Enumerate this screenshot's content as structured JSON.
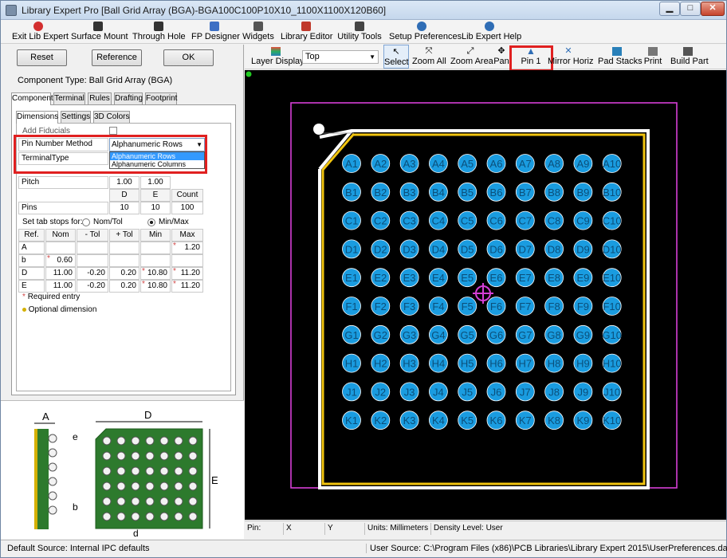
{
  "window": {
    "title": "Library Expert Pro [Ball Grid Array (BGA)-BGA100C100P10X10_1100X1100X120B60]"
  },
  "menu": [
    {
      "label": "Exit Lib Expert",
      "icon": "exit-icon",
      "color": "#d32f2f"
    },
    {
      "label": "Surface Mount",
      "icon": "chip-icon",
      "color": "#333333"
    },
    {
      "label": "Through Hole",
      "icon": "through-hole-icon",
      "color": "#333333"
    },
    {
      "label": "FP Designer",
      "icon": "pencil-icon",
      "color": "#3d6fc4"
    },
    {
      "label": "Widgets",
      "icon": "widgets-icon",
      "color": "#555555"
    },
    {
      "label": "Library Editor",
      "icon": "library-icon",
      "color": "#c0392b"
    },
    {
      "label": "Utility Tools",
      "icon": "tools-icon",
      "color": "#444444"
    },
    {
      "label": "Setup Preferences",
      "icon": "gear-icon",
      "color": "#2f6db5"
    },
    {
      "label": "Lib Expert Help",
      "icon": "help-icon",
      "color": "#2f6db5"
    }
  ],
  "left": {
    "buttons": {
      "reset": "Reset",
      "reference": "Reference",
      "ok": "OK"
    },
    "component_type": "Component Type: Ball Grid Array (BGA)",
    "tabs": [
      "Component",
      "Terminal",
      "Rules",
      "Drafting",
      "Footprint"
    ],
    "subtabs": [
      "Dimensions",
      "Settings",
      "3D Colors"
    ],
    "add_fiducials": "Add Fiducials",
    "pin_number_method_label": "Pin Number Method",
    "pin_number_method_value": "Alphanumeric Rows",
    "dropdown_options": [
      "Alphanumeric Rows",
      "Alphanumeric Columns"
    ],
    "terminal_type_label": "TerminalType",
    "pitch_label": "Pitch",
    "pitch_values": [
      "1.00",
      "1.00"
    ],
    "count_headers": [
      "D",
      "E",
      "Count"
    ],
    "pins_label": "Pins",
    "pins_values": [
      "10",
      "10",
      "100"
    ],
    "tab_stops_label": "Set tab stops for:",
    "radio_nom": "Nom/Tol",
    "radio_min": "Min/Max",
    "dim_headers": [
      "Ref.",
      "Nom",
      "- Tol",
      "+ Tol",
      "Min",
      "Max"
    ],
    "dim_rows": [
      {
        "ref": "A",
        "nom": "",
        "mtol": "",
        "ptol": "",
        "min": "",
        "max": "1.20"
      },
      {
        "ref": "b",
        "nom": "0.60",
        "mtol": "",
        "ptol": "",
        "min": "",
        "max": ""
      },
      {
        "ref": "D",
        "nom": "11.00",
        "mtol": "-0.20",
        "ptol": "0.20",
        "min": "10.80",
        "max": "11.20"
      },
      {
        "ref": "E",
        "nom": "11.00",
        "mtol": "-0.20",
        "ptol": "0.20",
        "min": "10.80",
        "max": "11.20"
      }
    ],
    "required_entry": "Required entry",
    "optional_dimension": "Optional dimension",
    "diagram_labels": {
      "A": "A",
      "D": "D",
      "E": "E",
      "e": "e",
      "b": "b",
      "d": "d"
    }
  },
  "toolbar": {
    "layer_display": "Layer Display",
    "layer_value": "Top",
    "items": [
      "Select",
      "Zoom All",
      "Zoom Area",
      "Pan",
      "Pin 1",
      "Mirror Horiz",
      "Pad Stacks",
      "Print",
      "Build Part"
    ]
  },
  "pads": {
    "rows": [
      "A",
      "B",
      "C",
      "D",
      "E",
      "F",
      "G",
      "H",
      "J",
      "K"
    ],
    "count": 10
  },
  "status_right": {
    "pin": "Pin:",
    "x": "X",
    "y": "Y",
    "units": "Units: Millimeters",
    "density": "Density Level: User"
  },
  "status": {
    "default_source": "Default Source:  Internal IPC defaults",
    "user_source": "User Source:   C:\\Program Files (x86)\\PCB Libraries\\Library Expert 2015\\UserPreferences.dat"
  },
  "colors": {
    "pad_fill": "#1a9ce0",
    "pad_text": "#0b4f7a",
    "silk_yellow": "#f1c40f",
    "courtyard": "#d63fd6",
    "highlight": "#e02020"
  }
}
